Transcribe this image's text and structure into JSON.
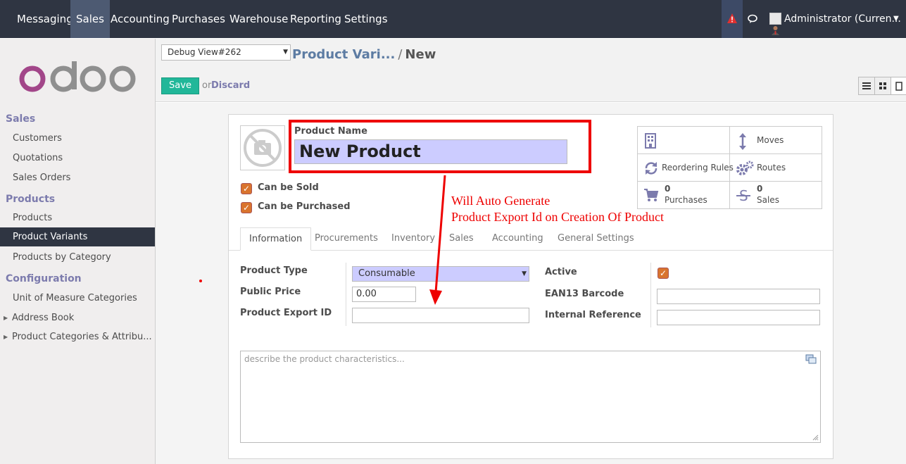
{
  "topbar": {
    "menu": [
      "Messaging",
      "Sales",
      "Accounting",
      "Purchases",
      "Warehouse",
      "Reporting",
      "Settings"
    ],
    "active": "Sales",
    "user": "Administrator (Curren...",
    "icons": [
      "alert-triangle-icon",
      "chat-icon",
      "caret-down-icon"
    ]
  },
  "sidebar": {
    "logo": "odoo",
    "sections": [
      {
        "title": "Sales",
        "items": [
          "Customers",
          "Quotations",
          "Sales Orders"
        ]
      },
      {
        "title": "Products",
        "items": [
          "Products",
          "Product Variants",
          "Products by Category"
        ]
      },
      {
        "title": "Configuration",
        "items": [
          "Unit of Measure Categories",
          "Address Book",
          "Product Categories & Attribu..."
        ]
      }
    ],
    "selected": "Product Variants"
  },
  "control_panel": {
    "debug_view": "Debug View#262",
    "breadcrumb_link": "Product Vari...",
    "breadcrumb_sep": "/",
    "breadcrumb_current": "New",
    "save_label": "Save",
    "or_text": "or",
    "discard_label": "Discard"
  },
  "form": {
    "product_name_label": "Product Name",
    "product_name_value": "New Product",
    "can_be_sold_label": "Can be Sold",
    "can_be_purchased_label": "Can be Purchased",
    "can_be_sold": true,
    "can_be_purchased": true,
    "smart_buttons": {
      "moves": "Moves",
      "reordering_rules": "Reordering Rules",
      "routes": "Routes",
      "purchases_count": "0",
      "purchases_label": "Purchases",
      "sales_count": "0",
      "sales_label": "Sales"
    },
    "annotation_line1": "Will Auto Generate",
    "annotation_line2": "Product Export Id on Creation Of Product",
    "tabs": [
      "Information",
      "Procurements",
      "Inventory",
      "Sales",
      "Accounting",
      "General Settings"
    ],
    "active_tab": "Information",
    "fields": {
      "product_type_label": "Product Type",
      "product_type_value": "Consumable",
      "public_price_label": "Public Price",
      "public_price_value": "0.00",
      "export_id_label": "Product Export ID",
      "export_id_value": "",
      "active_label": "Active",
      "active": true,
      "ean13_label": "EAN13 Barcode",
      "ean13_value": "",
      "internal_ref_label": "Internal Reference",
      "internal_ref_value": ""
    },
    "description_placeholder": "describe the product characteristics..."
  },
  "colors": {
    "topbar": "#2f3542",
    "accent": "#7c7bad",
    "save": "#21b799",
    "highlight_input": "#ccccff",
    "annotation": "#ee0000",
    "checkbox": "#d9742e"
  }
}
